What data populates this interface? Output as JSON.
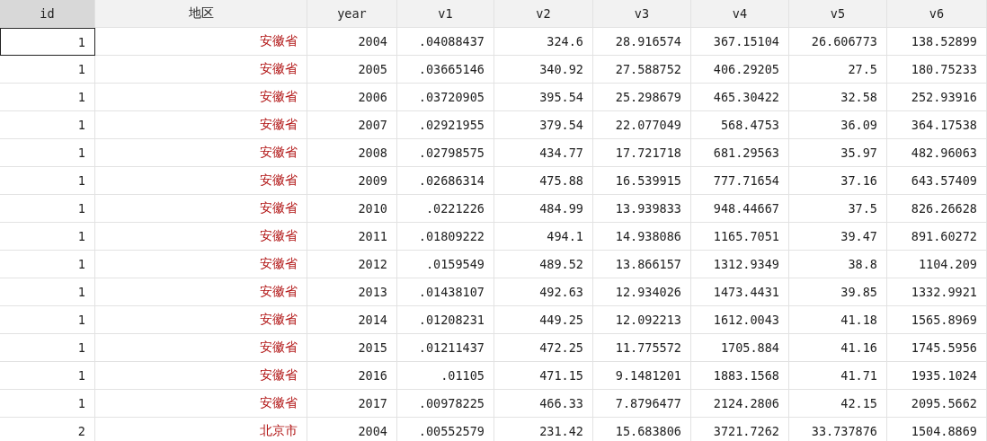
{
  "table": {
    "columns": [
      {
        "label": "id",
        "selected": true
      },
      {
        "label": "地区",
        "selected": false
      },
      {
        "label": "year",
        "selected": false
      },
      {
        "label": "v1",
        "selected": false
      },
      {
        "label": "v2",
        "selected": false
      },
      {
        "label": "v3",
        "selected": false
      },
      {
        "label": "v4",
        "selected": false
      },
      {
        "label": "v5",
        "selected": false
      },
      {
        "label": "v6",
        "selected": false
      }
    ],
    "rows": [
      {
        "selected": true,
        "cells": [
          "1",
          "安徽省",
          "2004",
          ".04088437",
          "324.6",
          "28.916574",
          "367.15104",
          "26.606773",
          "138.52899"
        ]
      },
      {
        "selected": false,
        "cells": [
          "1",
          "安徽省",
          "2005",
          ".03665146",
          "340.92",
          "27.588752",
          "406.29205",
          "27.5",
          "180.75233"
        ]
      },
      {
        "selected": false,
        "cells": [
          "1",
          "安徽省",
          "2006",
          ".03720905",
          "395.54",
          "25.298679",
          "465.30422",
          "32.58",
          "252.93916"
        ]
      },
      {
        "selected": false,
        "cells": [
          "1",
          "安徽省",
          "2007",
          ".02921955",
          "379.54",
          "22.077049",
          "568.4753",
          "36.09",
          "364.17538"
        ]
      },
      {
        "selected": false,
        "cells": [
          "1",
          "安徽省",
          "2008",
          ".02798575",
          "434.77",
          "17.721718",
          "681.29563",
          "35.97",
          "482.96063"
        ]
      },
      {
        "selected": false,
        "cells": [
          "1",
          "安徽省",
          "2009",
          ".02686314",
          "475.88",
          "16.539915",
          "777.71654",
          "37.16",
          "643.57409"
        ]
      },
      {
        "selected": false,
        "cells": [
          "1",
          "安徽省",
          "2010",
          ".0221226",
          "484.99",
          "13.939833",
          "948.44667",
          "37.5",
          "826.26628"
        ]
      },
      {
        "selected": false,
        "cells": [
          "1",
          "安徽省",
          "2011",
          ".01809222",
          "494.1",
          "14.938086",
          "1165.7051",
          "39.47",
          "891.60272"
        ]
      },
      {
        "selected": false,
        "cells": [
          "1",
          "安徽省",
          "2012",
          ".0159549",
          "489.52",
          "13.866157",
          "1312.9349",
          "38.8",
          "1104.209"
        ]
      },
      {
        "selected": false,
        "cells": [
          "1",
          "安徽省",
          "2013",
          ".01438107",
          "492.63",
          "12.934026",
          "1473.4431",
          "39.85",
          "1332.9921"
        ]
      },
      {
        "selected": false,
        "cells": [
          "1",
          "安徽省",
          "2014",
          ".01208231",
          "449.25",
          "12.092213",
          "1612.0043",
          "41.18",
          "1565.8969"
        ]
      },
      {
        "selected": false,
        "cells": [
          "1",
          "安徽省",
          "2015",
          ".01211437",
          "472.25",
          "11.775572",
          "1705.884",
          "41.16",
          "1745.5956"
        ]
      },
      {
        "selected": false,
        "cells": [
          "1",
          "安徽省",
          "2016",
          ".01105",
          "471.15",
          "9.1481201",
          "1883.1568",
          "41.71",
          "1935.1024"
        ]
      },
      {
        "selected": false,
        "cells": [
          "1",
          "安徽省",
          "2017",
          ".00978225",
          "466.33",
          "7.8796477",
          "2124.2806",
          "42.15",
          "2095.5662"
        ]
      },
      {
        "selected": false,
        "cells": [
          "2",
          "北京市",
          "2004",
          ".00552579",
          "231.42",
          "15.683806",
          "3721.7262",
          "33.737876",
          "1504.8869"
        ]
      }
    ]
  }
}
